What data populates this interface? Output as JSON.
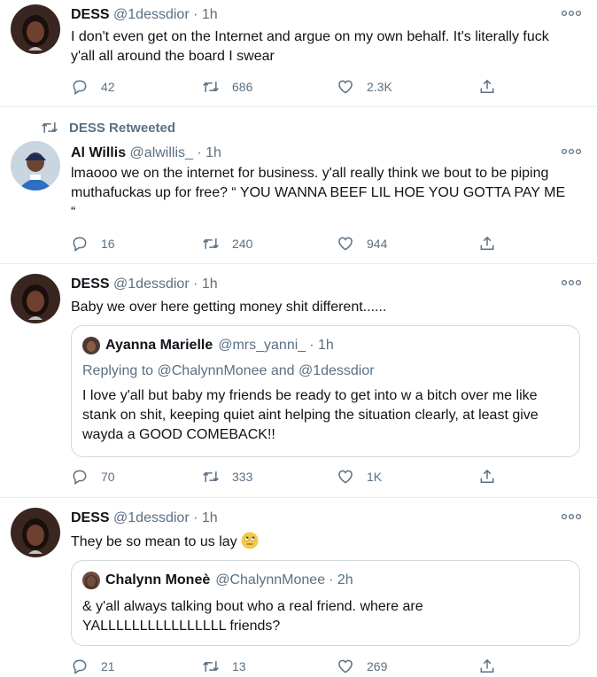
{
  "tweets": [
    {
      "name": "DESS",
      "handle": "@1dessdior",
      "time": "· 1h",
      "text": "I don't even get on the Internet and argue on my own behalf. It's literally fuck y'all all around the board I swear",
      "replies": "42",
      "retweets": "686",
      "likes": "2.3K"
    },
    {
      "retweeted_by": "DESS Retweeted",
      "name": "Al Willis",
      "handle": "@alwillis_",
      "time": "· 1h",
      "text": "lmaooo we on the internet for business. y'all really think we bout to be piping muthafuckas up for free? “ YOU WANNA BEEF LIL HOE YOU GOTTA PAY ME “",
      "replies": "16",
      "retweets": "240",
      "likes": "944"
    },
    {
      "name": "DESS",
      "handle": "@1dessdior",
      "time": "· 1h",
      "text": "Baby we over here getting money shit different......",
      "quote": {
        "name": "Ayanna Marielle",
        "handle": "@mrs_yanni_",
        "time": "· 1h",
        "replying_prefix": "Replying to",
        "replying_to": "@ChalynnMonee and @1dessdior",
        "text": "I love y'all but baby my friends be ready to get into w a bitch over me like stank on shit, keeping quiet aint helping the situation clearly, at least give wayda a GOOD COMEBACK!!"
      },
      "replies": "70",
      "retweets": "333",
      "likes": "1K"
    },
    {
      "name": "DESS",
      "handle": "@1dessdior",
      "time": "· 1h",
      "text": "They be so mean to us lay",
      "emoji": "face-with-rolling-eyes",
      "quote": {
        "name": "Chalynn Moneè",
        "handle": "@ChalynnMonee",
        "time": "· 2h",
        "text": "& y'all always talking bout who a real friend. where are YALLLLLLLLLLLLLLLL friends?"
      },
      "replies": "21",
      "retweets": "13",
      "likes": "269"
    }
  ],
  "colors": {
    "secondary_text": "#5b7083",
    "border": "#e6ecf0",
    "quote_border": "#cfd9de"
  },
  "icons": [
    "more-icon",
    "reply-icon",
    "retweet-icon",
    "like-icon",
    "share-icon",
    "avatar"
  ]
}
